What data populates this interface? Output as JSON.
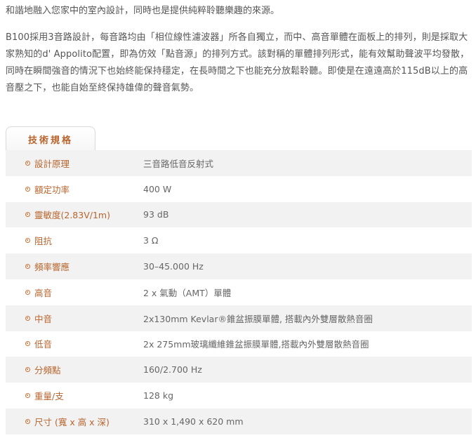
{
  "intro": {
    "line1": "和諧地融入您家中的室內設計，同時也是提供純粹聆聽樂趣的來源。",
    "paragraph": "B100採用3音路設計，每音路均由「相位線性濾波器」所各自獨立，而中、高音單體在面板上的排列，則是採取大家熟知的d' Appolito配置，即為仿效「點音源」的排列方式。該對稱的單體排列形式，能有效幫助聲波平均發散，同時在瞬間強音的情況下也始終能保持穩定，在長時間之下也能充分放鬆聆聽。即使是在遠遠高於115dB以上的高音壓之下，也能自始至終保持雄偉的聲音氣勢。"
  },
  "specs": {
    "tab_label": "技術規格",
    "rows": [
      {
        "label": "設計原理",
        "value": "三音路低音反射式"
      },
      {
        "label": "額定功率",
        "value": "400 W"
      },
      {
        "label": "靈敏度(2.83V/1m)",
        "value": "93 dB"
      },
      {
        "label": "阻抗",
        "value": "3 Ω"
      },
      {
        "label": "頻率響應",
        "value": "30–45.000 Hz"
      },
      {
        "label": "高音",
        "value": "2 x 氣動（AMT）單體"
      },
      {
        "label": "中音",
        "value": "2x130mm Kevlar®錐盆振膜單體, 搭載內外雙層散熱音圈"
      },
      {
        "label": "低音",
        "value": "2x 275mm玻璃纖維錐盆振膜單體,搭載內外雙層散熱音圈"
      },
      {
        "label": "分頻點",
        "value": "160/2.700 Hz"
      },
      {
        "label": "重量/支",
        "value": "128 kg"
      },
      {
        "label": "尺寸 (寬 x 高 x 深)",
        "value": "310 x 1,490 x 620 mm"
      }
    ]
  },
  "colors": {
    "accent": "#b8642c",
    "text": "#555555",
    "row_shade": "#f2f2f2"
  }
}
